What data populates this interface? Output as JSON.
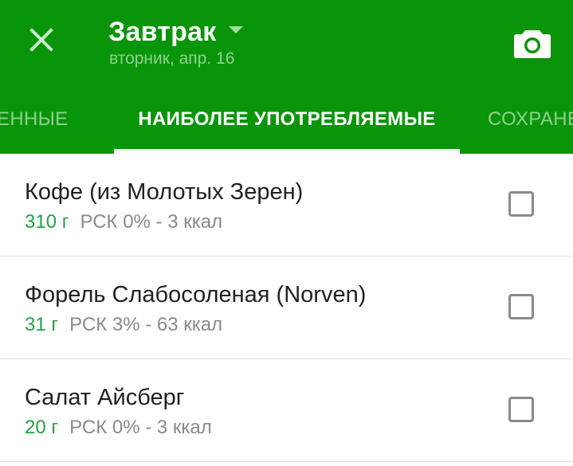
{
  "header": {
    "title": "Завтрак",
    "subtitle": "вторник, апр. 16",
    "close_icon": "close-icon",
    "dropdown_icon": "dropdown-arrow-icon",
    "camera_icon": "camera-icon",
    "background_color": "#099509"
  },
  "tabs": [
    {
      "label": "ЛЕННЫЕ",
      "active": false
    },
    {
      "label": "НАИБОЛЕЕ УПОТРЕБЛЯЕМЫЕ",
      "active": true
    },
    {
      "label": "СОХРАНЕ",
      "active": false
    }
  ],
  "items": [
    {
      "name": "Кофе (из Молотых Зерен)",
      "amount": "310 г",
      "details": "РСК 0% - 3 ккал",
      "checked": false
    },
    {
      "name": "Форель Слабосоленая (Norven)",
      "amount": "31 г",
      "details": "РСК 3% - 63 ккал",
      "checked": false
    },
    {
      "name": "Салат Айсберг",
      "amount": "20 г",
      "details": "РСК 0% - 3 ккал",
      "checked": false
    }
  ],
  "colors": {
    "primary": "#099509",
    "amount_text": "#24a046",
    "secondary_text": "#8a8a8a"
  }
}
